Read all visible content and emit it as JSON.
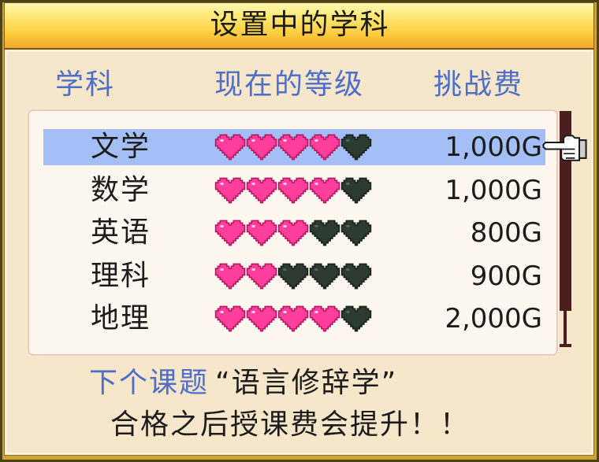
{
  "window": {
    "title": "设置中的学科"
  },
  "columns": {
    "subject": "学科",
    "level": "现在的等级",
    "fee": "挑战费"
  },
  "subjects": [
    {
      "name": "文学",
      "level": 4,
      "max_level": 5,
      "fee": "1,000G",
      "selected": true
    },
    {
      "name": "数学",
      "level": 4,
      "max_level": 5,
      "fee": "1,000G",
      "selected": false
    },
    {
      "name": "英语",
      "level": 3,
      "max_level": 5,
      "fee": "800G",
      "selected": false
    },
    {
      "name": "理科",
      "level": 2,
      "max_level": 5,
      "fee": "900G",
      "selected": false
    },
    {
      "name": "地理",
      "level": 4,
      "max_level": 5,
      "fee": "2,000G",
      "selected": false
    }
  ],
  "next_topic": {
    "label": "下个课题",
    "value": "“语言修辞学”"
  },
  "notice": "合格之后授课费会提升！！",
  "icons": {
    "cursor": "pointing-hand-icon",
    "level_filled": "heart-icon",
    "level_empty": "heart-empty-icon"
  },
  "colors": {
    "title_bar": "#ffd94a",
    "header_text": "#4d6fcb",
    "selected_row": "#a3bff5",
    "heart_filled": "#ff3f9b",
    "heart_empty": "#2c3b31",
    "scrollbar": "#4b1f1f"
  }
}
